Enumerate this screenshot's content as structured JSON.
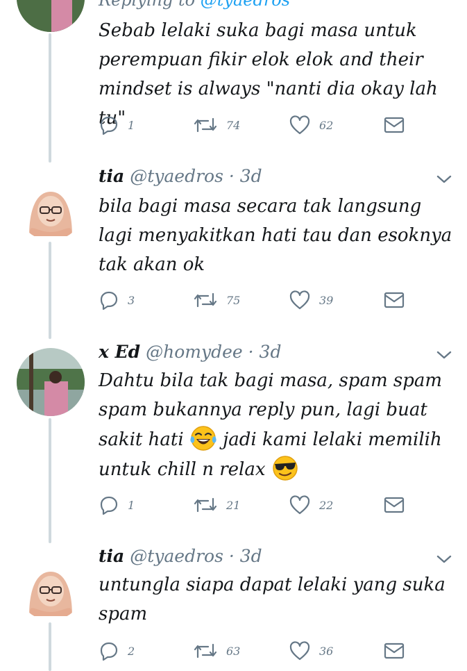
{
  "replying_to": {
    "prefix": "Replying to",
    "mention": "@tyaedros"
  },
  "tweets": [
    {
      "text": "Sebab lelaki suka bagi masa untuk perempuan fikir elok elok and their mindset is always \"nanti dia okay lah tu\"",
      "replies": "1",
      "retweets": "74",
      "likes": "62"
    },
    {
      "name": "tia",
      "handle": "@tyaedros",
      "dot": "·",
      "time": "3d",
      "text": "bila bagi masa secara tak langsung lagi menyakitkan hati tau dan esoknya tak akan ok",
      "replies": "3",
      "retweets": "75",
      "likes": "39"
    },
    {
      "name": "x Ed",
      "handle": "@homydee",
      "dot": "·",
      "time": "3d",
      "text_a": "Dahtu bila tak bagi masa, spam spam spam bukannya reply pun, lagi buat sakit hati",
      "emoji_a": "face-with-tears-of-joy",
      "text_b": "jadi kami lelaki memilih untuk chill n relax",
      "emoji_b": "smiling-face-with-sunglasses",
      "replies": "1",
      "retweets": "21",
      "likes": "22"
    },
    {
      "name": "tia",
      "handle": "@tyaedros",
      "dot": "·",
      "time": "3d",
      "text": "untungla siapa dapat lelaki yang suka spam",
      "replies": "2",
      "retweets": "63",
      "likes": "36"
    }
  ],
  "colors": {
    "name": "#14171a",
    "secondary": "#657786",
    "thread": "#cfd9de",
    "link": "#1da1f2"
  }
}
